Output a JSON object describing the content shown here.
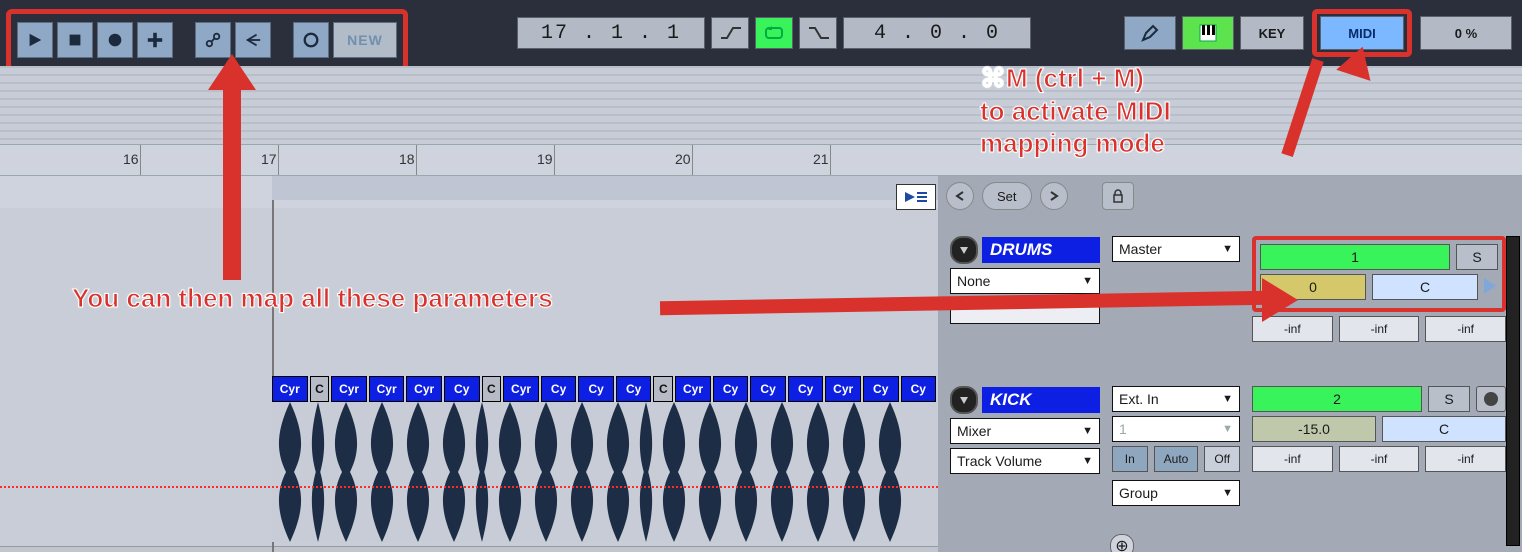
{
  "transport": {
    "new_label": "NEW",
    "position": "17 .  1 .  1",
    "tempo": "4 .  0 .  0"
  },
  "right": {
    "key_label": "KEY",
    "midi_label": "MIDI",
    "pct_label": "0 %"
  },
  "ruler": {
    "ticks": [
      "16",
      "17",
      "18",
      "19",
      "20",
      "21"
    ]
  },
  "nav": {
    "set_label": "Set"
  },
  "clips": {
    "names": [
      "Cyr",
      "C",
      "Cyr",
      "Cyr",
      "Cyr",
      "Cy",
      "C",
      "Cyr",
      "Cy",
      "Cy",
      "Cy",
      "C",
      "Cyr",
      "Cy",
      "Cy",
      "Cy",
      "Cyr",
      "Cy",
      "Cy"
    ]
  },
  "tracks": {
    "drums": {
      "name": "DRUMS",
      "routing": "Master",
      "sub": "None",
      "param1": "1",
      "solo": "S",
      "param2": "0",
      "pan": "C",
      "inf": "-inf"
    },
    "kick": {
      "name": "KICK",
      "routing": "Ext. In",
      "r2": "Mixer",
      "r3": "Track Volume",
      "r4": "Group",
      "ch": "1",
      "in": "In",
      "auto": "Auto",
      "off": "Off",
      "param1": "2",
      "solo": "S",
      "gain": "-15.0",
      "pan": "C",
      "inf": "-inf"
    }
  },
  "annotations": {
    "a1": "⌘M (ctrl + M)\nto activate MIDI\nmapping mode",
    "a2": "You can then map all these parameters"
  }
}
